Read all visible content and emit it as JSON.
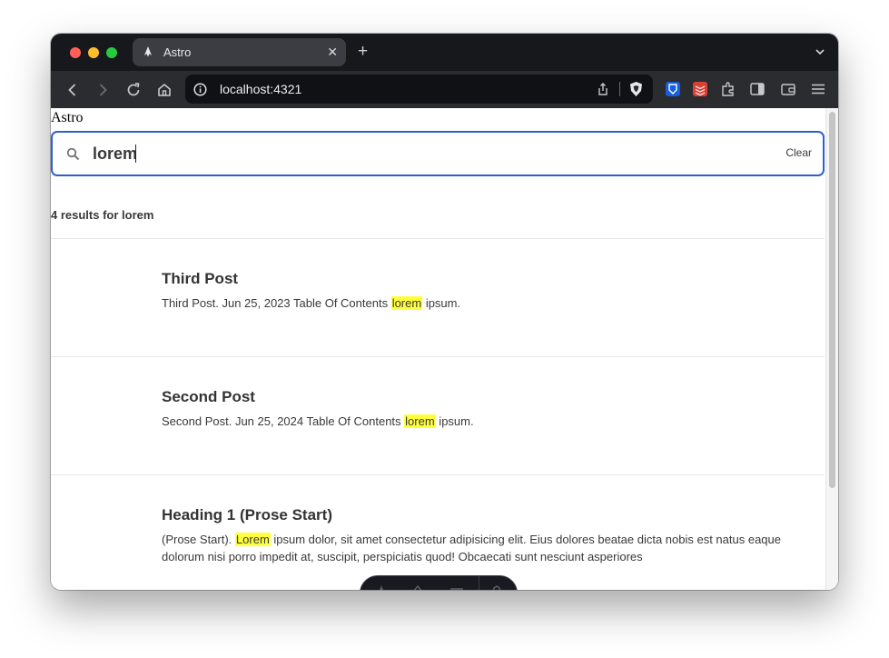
{
  "browser": {
    "tab": {
      "title": "Astro",
      "close_glyph": "✕"
    },
    "new_tab_glyph": "+",
    "url": "localhost:4321",
    "colors": {
      "tabbar": "#17181c",
      "toolbar": "#2b2c30",
      "urlbar": "#101114"
    },
    "icons": [
      "back-icon",
      "forward-icon",
      "reload-icon",
      "home-icon",
      "site-info-icon",
      "share-icon",
      "brave-shield-icon",
      "bitwarden-icon",
      "todoist-icon",
      "extensions-icon",
      "sidebar-icon",
      "wallet-icon",
      "menu-icon"
    ]
  },
  "page": {
    "site_title": "Astro",
    "search": {
      "value": "lorem",
      "clear_label": "Clear",
      "accent": "#2e5fd1"
    },
    "results_count": "4 results for lorem",
    "highlight_color": "#ffff3d",
    "results": [
      {
        "title": "Third Post",
        "excerpt_before": "Third Post. Jun 25, 2023 Table Of Contents ",
        "excerpt_match": "lorem",
        "excerpt_after": " ipsum."
      },
      {
        "title": "Second Post",
        "excerpt_before": "Second Post. Jun 25, 2024 Table Of Contents ",
        "excerpt_match": "lorem",
        "excerpt_after": " ipsum."
      },
      {
        "title": "Heading 1 (Prose Start)",
        "excerpt_before": "(Prose Start). ",
        "excerpt_match": "Lorem",
        "excerpt_after": " ipsum dolor, sit amet consectetur adipisicing elit. Eius dolores beatae dicta nobis est natus eaque dolorum nisi porro impedit at, suscipit, perspiciatis quod! Obcaecati sunt nesciunt asperiores"
      }
    ]
  },
  "dev_toolbar": {
    "icons": [
      "astro-menu-icon",
      "audit-icon",
      "settings-list-icon",
      "settings-gear-icon"
    ]
  }
}
